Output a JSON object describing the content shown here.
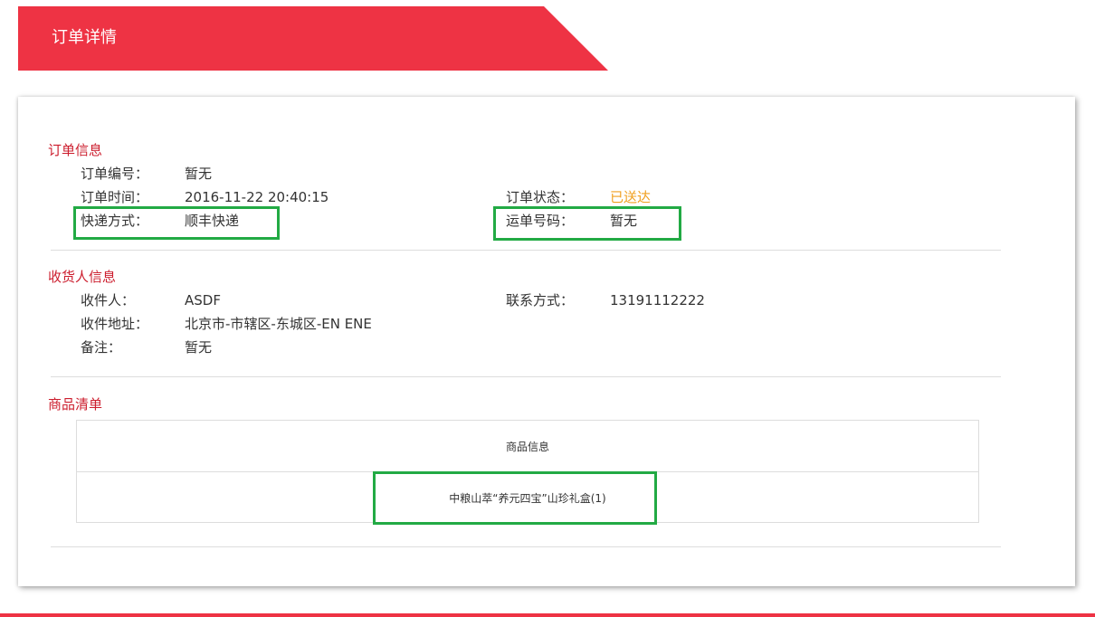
{
  "header": {
    "title": "订单详情"
  },
  "order_info": {
    "section_title": "订单信息",
    "order_no_label": "订单编号：",
    "order_no_value": "暂无",
    "order_time_label": "订单时间：",
    "order_time_value": "2016-11-22 20:40:15",
    "order_status_label": "订单状态：",
    "order_status_value": "已送达",
    "delivery_label": "快递方式：",
    "delivery_value": "顺丰快递",
    "waybill_label": "运单号码：",
    "waybill_value": "暂无"
  },
  "receiver_info": {
    "section_title": "收货人信息",
    "receiver_label": "收件人：",
    "receiver_value": "ASDF",
    "contact_label": "联系方式：",
    "contact_value": "13191112222",
    "address_label": "收件地址：",
    "address_value": "北京市-市辖区-东城区-EN ENE",
    "remark_label": "备注：",
    "remark_value": "暂无"
  },
  "goods": {
    "section_title": "商品清单",
    "column_header": "商品信息",
    "items": [
      {
        "name": "中粮山萃“养元四宝”山珍礼盒(1)"
      }
    ]
  },
  "colors": {
    "accent": "#ee3344",
    "section_title": "#cc1e2e",
    "status": "#f0a020",
    "highlight": "#22aa44"
  }
}
